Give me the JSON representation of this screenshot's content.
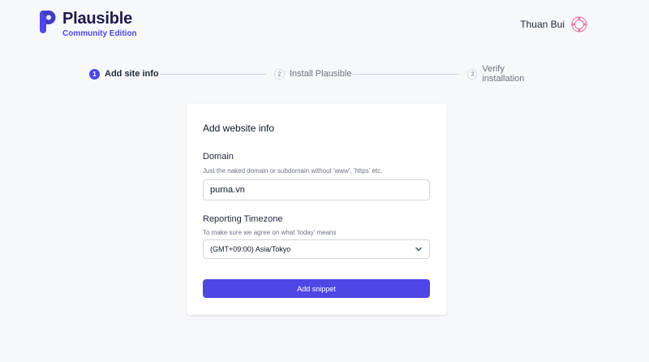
{
  "brand": {
    "name": "Plausible",
    "edition": "Community Edition",
    "accent": "#4f46e5"
  },
  "user": {
    "name": "Thuan Bui",
    "avatar_icon": "avatar-icon"
  },
  "steps": [
    {
      "number": "1",
      "label": "Add site info",
      "state": "active"
    },
    {
      "number": "2",
      "label": "Install Plausible",
      "state": "inactive"
    },
    {
      "number": "3",
      "label": "Verify installation",
      "state": "inactive"
    }
  ],
  "form": {
    "title": "Add website info",
    "domain": {
      "label": "Domain",
      "help": "Just the naked domain or subdomain without 'www', 'https' etc.",
      "value": "purna.vn"
    },
    "timezone": {
      "label": "Reporting Timezone",
      "help": "To make sure we agree on what 'today' means",
      "selected": "(GMT+09:00) Asia/Tokyo"
    },
    "submit_label": "Add snippet"
  }
}
